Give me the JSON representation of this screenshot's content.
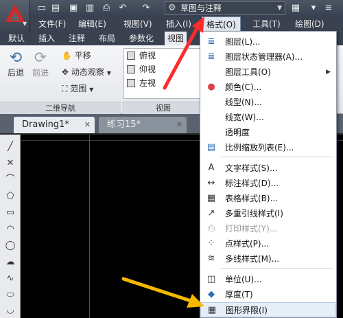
{
  "app": {
    "workspace": "草图与注释"
  },
  "menubar": {
    "items": [
      "文件(F)",
      "编辑(E)",
      "视图(V)",
      "插入(I)",
      "格式(O)",
      "工具(T)",
      "绘图(D)"
    ]
  },
  "ribbon": {
    "tabs": [
      "默认",
      "插入",
      "注释",
      "布局",
      "参数化",
      "视图"
    ],
    "nav": {
      "back": "后退",
      "forward": "前进",
      "pan": "平移",
      "orbit": "动态观察",
      "range": "范围",
      "panel_title": "二维导航"
    },
    "views": {
      "items": [
        "俯视",
        "仰视",
        "左视"
      ],
      "panel_title": "视图"
    }
  },
  "doc_tabs": [
    "Drawing1*",
    "练习15*"
  ],
  "format_menu": {
    "items": [
      {
        "label": "图层(L)...",
        "icon": "layer-icon",
        "color": "#2f6fb7"
      },
      {
        "label": "图层状态管理器(A)...",
        "icon": "layer-state-icon",
        "color": "#2f6fb7"
      },
      {
        "label": "图层工具(O)",
        "icon": "",
        "submenu": true
      },
      {
        "label": "颜色(C)...",
        "icon": "color-wheel-icon",
        "color": "#e0404a"
      },
      {
        "label": "线型(N)...",
        "icon": ""
      },
      {
        "label": "线宽(W)...",
        "icon": ""
      },
      {
        "label": "透明度",
        "icon": ""
      },
      {
        "label": "比例缩放列表(E)...",
        "icon": "scale-list-icon",
        "color": "#2f6fb7"
      },
      {
        "label": "文字样式(S)...",
        "icon": "text-style-icon",
        "color": "#333333"
      },
      {
        "label": "标注样式(D)...",
        "icon": "dim-style-icon",
        "color": "#333333"
      },
      {
        "label": "表格样式(B)...",
        "icon": "table-style-icon",
        "color": "#333333"
      },
      {
        "label": "多重引线样式(I)",
        "icon": "multileader-icon",
        "color": "#333333"
      },
      {
        "label": "打印样式(Y)...",
        "icon": "print-style-icon",
        "color": "#9a9a9a",
        "disabled": true
      },
      {
        "label": "点样式(P)...",
        "icon": "point-style-icon",
        "color": "#333333"
      },
      {
        "label": "多线样式(M)...",
        "icon": "multiline-style-icon",
        "color": "#333333"
      },
      {
        "label": "单位(U)...",
        "icon": "units-icon",
        "color": "#333333"
      },
      {
        "label": "厚度(T)",
        "icon": "thickness-icon",
        "color": "#2f6fb7"
      },
      {
        "label": "图形界限(I)",
        "icon": "limits-icon",
        "color": "#333333"
      }
    ]
  },
  "colors": {
    "arrow_red": "#ff2b2b",
    "arrow_yellow": "#f5b800",
    "menu_highlight": "#e6eef8"
  }
}
